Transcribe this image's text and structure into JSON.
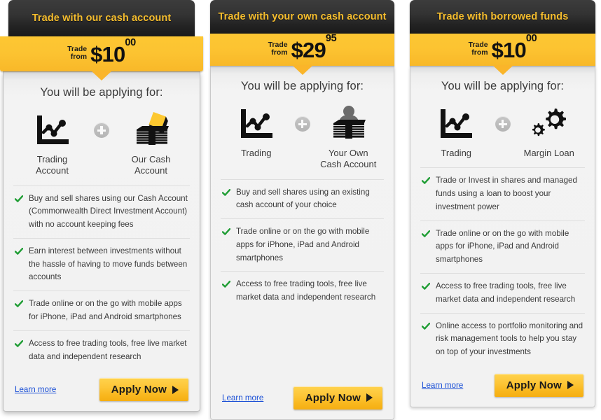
{
  "cards": [
    {
      "title": "Trade with our cash account",
      "price": {
        "label_line1": "Trade",
        "label_line2": "from",
        "amount": "$10",
        "cents": "00"
      },
      "applying_heading": "You will be applying for:",
      "icons": [
        {
          "name": "trading-chart-icon",
          "label": "Trading\nAccount"
        },
        {
          "name": "our-cash-account-icon",
          "label": "Our Cash\nAccount"
        }
      ],
      "plus_icon": "plus-circle-icon",
      "bullets": [
        "Buy and sell shares using our Cash Account (Commonwealth Direct Investment Account) with no account keeping fees",
        "Earn interest between investments without the hassle of having to move funds between accounts",
        "Trade online or on the go with mobile apps for iPhone, iPad and Android smartphones",
        "Access to free trading tools, free live market data and independent research"
      ],
      "learn_more": "Learn more",
      "apply": "Apply Now"
    },
    {
      "title": "Trade with your own cash account",
      "price": {
        "label_line1": "Trade",
        "label_line2": "from",
        "amount": "$29",
        "cents": "95"
      },
      "applying_heading": "You will be applying for:",
      "icons": [
        {
          "name": "trading-chart-icon",
          "label": "Trading"
        },
        {
          "name": "your-own-cash-account-icon",
          "label": "Your Own\nCash Account"
        }
      ],
      "plus_icon": "plus-circle-icon",
      "bullets": [
        "Buy and sell shares using an existing cash account of your choice",
        "Trade online or on the go with mobile apps for iPhone, iPad and Android smartphones",
        "Access to free trading tools, free live market data and independent research"
      ],
      "learn_more": "Learn more",
      "apply": "Apply Now"
    },
    {
      "title": "Trade with borrowed funds",
      "price": {
        "label_line1": "Trade",
        "label_line2": "from",
        "amount": "$10",
        "cents": "00"
      },
      "applying_heading": "You will be applying for:",
      "icons": [
        {
          "name": "trading-chart-icon",
          "label": "Trading"
        },
        {
          "name": "margin-loan-gears-icon",
          "label": "Margin Loan"
        }
      ],
      "plus_icon": "plus-circle-icon",
      "bullets": [
        "Trade or Invest in shares and managed funds using a loan to boost your investment power",
        "Trade online or on the go with mobile apps for iPhone, iPad and Android smartphones",
        "Access to free trading tools, free live market data and independent research",
        "Online access to portfolio monitoring and risk management tools to help you stay on top of your investments"
      ],
      "learn_more": "Learn more",
      "apply": "Apply Now"
    }
  ],
  "colors": {
    "header_bg": "#2b2b2b",
    "header_text": "#f5bd2e",
    "price_band": "#fcc331",
    "check_green": "#1f9d34",
    "link_blue": "#1a4fd6",
    "button_yellow": "#fdc638",
    "diamond_yellow": "#fdc82f"
  }
}
